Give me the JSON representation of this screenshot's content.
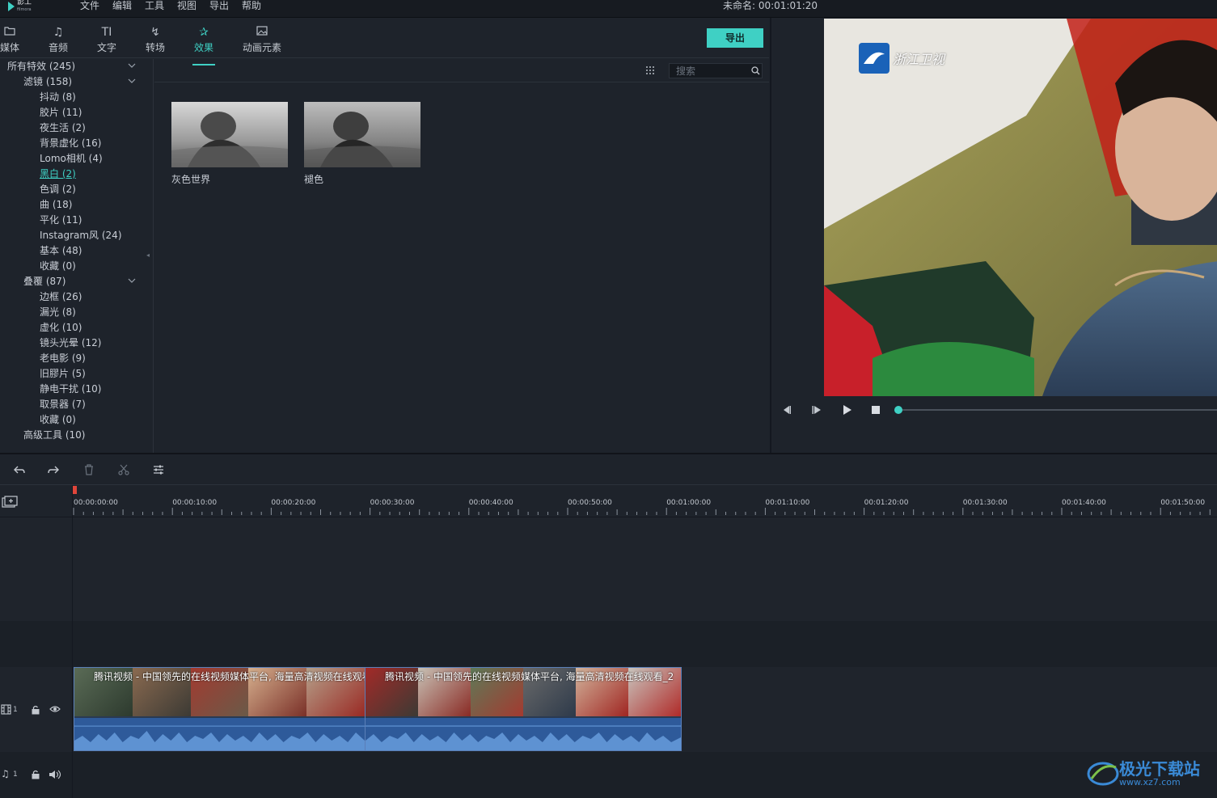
{
  "app": {
    "logo_text": "影工",
    "logo_sub": "filmora",
    "menu": [
      "文件",
      "编辑",
      "工具",
      "视图",
      "导出",
      "帮助"
    ],
    "project_title": "未命名: 00:01:01:20"
  },
  "tabs": [
    {
      "label": "媒体",
      "icon": "folder-icon"
    },
    {
      "label": "音频",
      "icon": "music-note-icon"
    },
    {
      "label": "文字",
      "icon": "text-icon"
    },
    {
      "label": "转场",
      "icon": "transition-icon"
    },
    {
      "label": "效果",
      "icon": "effects-icon",
      "active": true
    },
    {
      "label": "动画元素",
      "icon": "image-icon"
    }
  ],
  "export_label": "导出",
  "sidebar": {
    "items": [
      {
        "label": "所有特效 (245)",
        "level": 0,
        "expandable": true
      },
      {
        "label": "滤镜 (158)",
        "level": 1,
        "expandable": true
      },
      {
        "label": "抖动 (8)",
        "level": 2
      },
      {
        "label": "胶片 (11)",
        "level": 2
      },
      {
        "label": "夜生活 (2)",
        "level": 2
      },
      {
        "label": "背景虚化 (16)",
        "level": 2
      },
      {
        "label": "Lomo相机 (4)",
        "level": 2
      },
      {
        "label": "黑白 (2)",
        "level": 2,
        "selected": true
      },
      {
        "label": "色调 (2)",
        "level": 2
      },
      {
        "label": "曲 (18)",
        "level": 2
      },
      {
        "label": "平化 (11)",
        "level": 2
      },
      {
        "label": "Instagram风 (24)",
        "level": 2
      },
      {
        "label": "基本 (48)",
        "level": 2
      },
      {
        "label": "收藏 (0)",
        "level": 2
      },
      {
        "label": "叠覆 (87)",
        "level": 1,
        "expandable": true
      },
      {
        "label": "边框 (26)",
        "level": 2
      },
      {
        "label": "漏光 (8)",
        "level": 2
      },
      {
        "label": "虚化 (10)",
        "level": 2
      },
      {
        "label": "镜头光晕 (12)",
        "level": 2
      },
      {
        "label": "老电影 (9)",
        "level": 2
      },
      {
        "label": "旧膠片 (5)",
        "level": 2
      },
      {
        "label": "静电干扰 (10)",
        "level": 2
      },
      {
        "label": "取景器 (7)",
        "level": 2
      },
      {
        "label": "收藏 (0)",
        "level": 2
      },
      {
        "label": "高级工具 (10)",
        "level": 1
      }
    ]
  },
  "search": {
    "placeholder": "搜索"
  },
  "effects": [
    {
      "label": "灰色世界"
    },
    {
      "label": "褪色"
    }
  ],
  "preview": {
    "channel_logo": "浙江卫视",
    "progress": 0.0
  },
  "timeline": {
    "ticks": [
      "00:00:00:00",
      "00:00:10:00",
      "00:00:20:00",
      "00:00:30:00",
      "00:00:40:00",
      "00:00:50:00",
      "00:01:00:00",
      "00:01:10:00",
      "00:01:20:00",
      "00:01:30:00",
      "00:01:40:00",
      "00:01:50:00"
    ],
    "video_track_num": "1",
    "audio_track_num": "1",
    "clips": [
      {
        "title": "腾讯视频 - 中国领先的在线视频媒体平台, 海量高清视频在线观看"
      },
      {
        "title": "腾讯视频 - 中国领先的在线视频媒体平台, 海量高清视频在线观看_2"
      }
    ]
  },
  "watermark": {
    "title": "极光下载站",
    "url": "www.xz7.com"
  },
  "colors": {
    "accent": "#3fd0c4",
    "background": "#1e232b",
    "clip_audio": "#2e5a9a",
    "playhead": "#e0453a"
  }
}
